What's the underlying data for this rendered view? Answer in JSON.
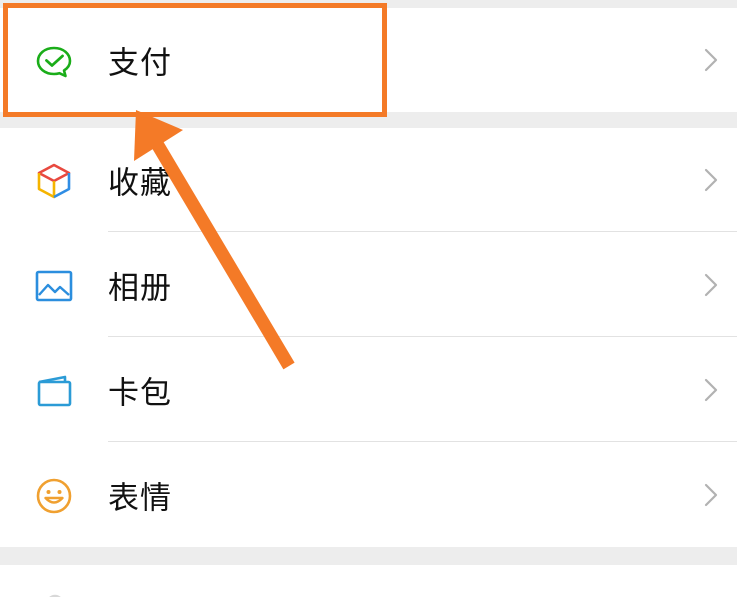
{
  "menu": {
    "pay": {
      "label": "支付",
      "icon": "wechat-pay-icon",
      "color": "#1aad19"
    },
    "favorites": {
      "label": "收藏",
      "icon": "cube-icon"
    },
    "album": {
      "label": "相册",
      "icon": "image-icon",
      "color": "#2b8ede"
    },
    "cards": {
      "label": "卡包",
      "icon": "wallet-icon",
      "color": "#2b9bd6"
    },
    "stickers": {
      "label": "表情",
      "icon": "smiley-icon",
      "color": "#f0a030"
    }
  },
  "colors": {
    "highlight": "#f47a27",
    "group_gap": "#ededed",
    "chevron": "#b2b2b2"
  }
}
